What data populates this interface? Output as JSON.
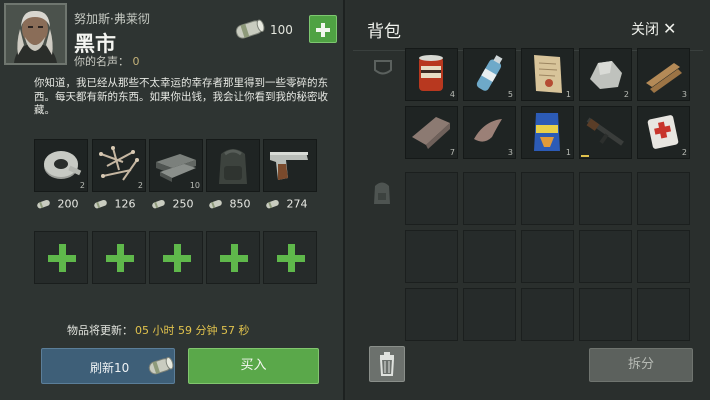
{
  "trader": {
    "name": "努加斯·弗莱彻",
    "shop_title": "黑市",
    "reputation_label": "你的名声：",
    "reputation_value": "0"
  },
  "currency": {
    "amount": "100",
    "icon": "cash-roll-icon",
    "add_icon": "plus-icon"
  },
  "description": "你知道，我已经从那些不太幸运的幸存者那里得到一些零碎的东西。每天都有新的东西。如果你出钱，我会让你看到我的秘密收藏。",
  "shop_items": [
    {
      "icon": "duct-tape-icon",
      "count": "2",
      "price": "200"
    },
    {
      "icon": "nails-icon",
      "count": "2",
      "price": "126"
    },
    {
      "icon": "metal-bars-icon",
      "count": "10",
      "price": "250"
    },
    {
      "icon": "backpack-icon",
      "count": "",
      "price": "850"
    },
    {
      "icon": "pistol-icon",
      "count": "",
      "price": "274"
    }
  ],
  "add_slots": [
    "plus-icon",
    "plus-icon",
    "plus-icon",
    "plus-icon",
    "plus-icon"
  ],
  "timer": {
    "label": "物品将更新：",
    "value": "05 小时 59 分钟 57 秒"
  },
  "buttons": {
    "refresh_label": "刷新10",
    "buy_label": "买入",
    "split_label": "拆分",
    "close_label": "关闭",
    "close_icon": "close-icon",
    "trash_icon": "trash-icon"
  },
  "backpack": {
    "title": "背包",
    "pocket_icon": "pocket-icon",
    "bag_icon": "backpack-icon",
    "items": [
      {
        "icon": "canned-food-icon",
        "count": "4"
      },
      {
        "icon": "water-bottle-icon",
        "count": "5"
      },
      {
        "icon": "paper-note-icon",
        "count": "1"
      },
      {
        "icon": "stone-icon",
        "count": "2"
      },
      {
        "icon": "wood-plank-icon",
        "count": "3"
      },
      {
        "icon": "cloth-icon",
        "count": "7"
      },
      {
        "icon": "leather-icon",
        "count": "3"
      },
      {
        "icon": "chips-bag-icon",
        "count": "1"
      },
      {
        "icon": "assault-rifle-icon",
        "count": ""
      },
      {
        "icon": "medkit-icon",
        "count": "2"
      }
    ]
  },
  "colors": {
    "accent_green": "#5aa84a",
    "refresh_blue": "#3e5f78",
    "timer_yellow": "#e0c24d",
    "background": "#2b302e"
  }
}
